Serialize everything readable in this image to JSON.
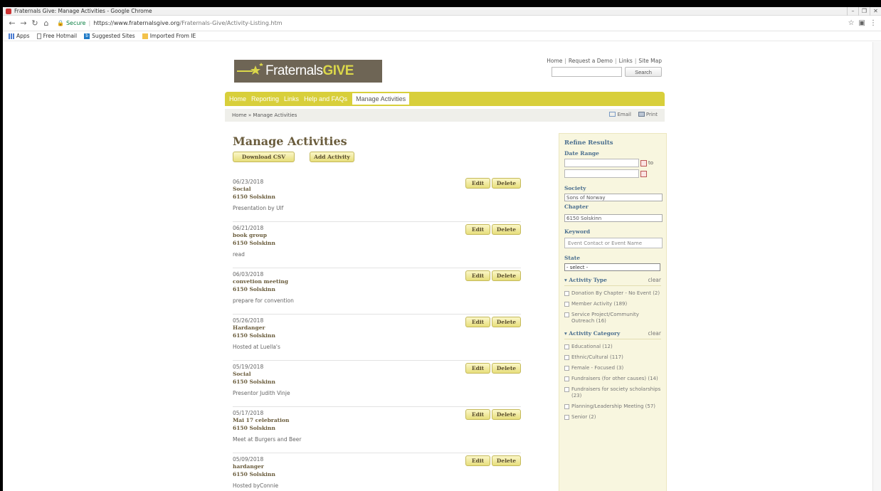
{
  "browser": {
    "window_title": "Fraternals Give: Manage Activities - Google Chrome",
    "secure_label": "Secure",
    "url_host": "https://www.fraternalsgive.org",
    "url_path": "/Fraternals-Give/Activity-Listing.htm",
    "bookmarks": [
      "Apps",
      "Free Hotmail",
      "Suggested Sites",
      "Imported From IE"
    ]
  },
  "header": {
    "top_links": [
      "Home",
      "Request a Demo",
      "Links",
      "Site Map"
    ],
    "search_button": "Search",
    "logo_text": "Fraternals",
    "logo_give": "GIVE"
  },
  "nav": {
    "items": [
      "Home",
      "Reporting",
      "Links",
      "Help and FAQs"
    ],
    "active": "Manage Activities"
  },
  "breadcrumb": "Home » Manage Activities",
  "tools": {
    "email": "Email",
    "print": "Print"
  },
  "main": {
    "title": "Manage Activities",
    "download_csv": "Download CSV",
    "add_activity": "Add Activity",
    "edit_label": "Edit",
    "delete_label": "Delete",
    "activities": [
      {
        "date": "06/23/2018",
        "name": "Social",
        "chapter": "6150 Solskinn",
        "description": "Presentation by Ulf"
      },
      {
        "date": "06/21/2018",
        "name": "book group",
        "chapter": "6150 Solskinn",
        "description": "read"
      },
      {
        "date": "06/03/2018",
        "name": "convetion meeting",
        "chapter": "6150 Solskinn",
        "description": "prepare for convention"
      },
      {
        "date": "05/26/2018",
        "name": "Hardanger",
        "chapter": "6150 Solskinn",
        "description": "Hosted at Luella's"
      },
      {
        "date": "05/19/2018",
        "name": "Social",
        "chapter": "6150 Solskinn",
        "description": "Presentor Judith Vinje"
      },
      {
        "date": "05/17/2018",
        "name": "Mai 17 celebration",
        "chapter": "6150 Solskinn",
        "description": "Meet at Burgers and Beer"
      },
      {
        "date": "05/09/2018",
        "name": "hardanger",
        "chapter": "6150 Solskinn",
        "description": "Hosted byConnie"
      }
    ]
  },
  "refine": {
    "title": "Refine Results",
    "date_range_label": "Date Range",
    "to_label": "to",
    "society_label": "Society",
    "society_value": "Sons of Norway",
    "chapter_label": "Chapter",
    "chapter_value": "6150 Solskinn",
    "keyword_label": "Keyword",
    "keyword_placeholder": "Event Contact or Event Name",
    "state_label": "State",
    "state_value": "- select -",
    "activity_type_label": "▾ Activity Type",
    "activity_category_label": "▾ Activity Category",
    "clear_label": "clear",
    "activity_types": [
      "Donation By Chapter - No Event (2)",
      "Member Activity (189)",
      "Service Project/Community Outreach (16)"
    ],
    "activity_categories": [
      "Educational (12)",
      "Ethnic/Cultural (117)",
      "Female - Focused (3)",
      "Fundraisers (for other causes) (14)",
      "Fundraisers for society scholarships (23)",
      "Planning/Leadership Meeting (57)",
      "Senior (2)"
    ]
  }
}
